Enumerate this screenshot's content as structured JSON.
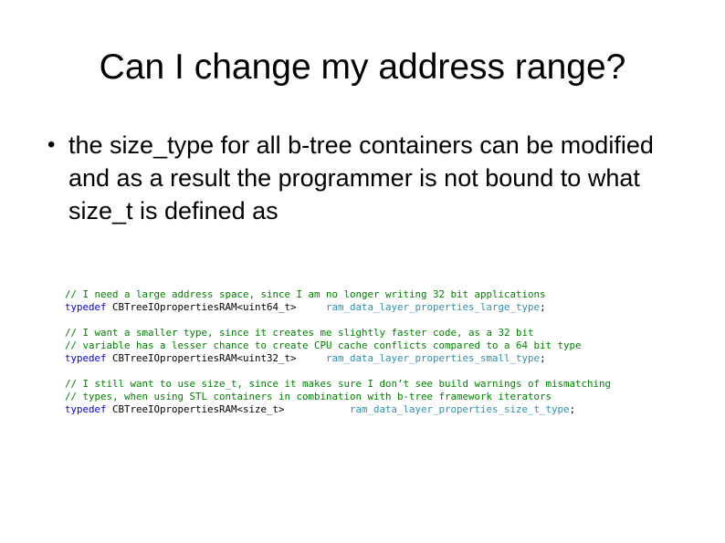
{
  "slide": {
    "title": "Can I change my address range?",
    "bullets": [
      "the size_type for all b-tree containers can be modified and as a result the programmer is not bound to what size_t is defined as"
    ]
  },
  "code": {
    "lines": [
      {
        "comment": "// I need a large address space, since I am no longer writing 32 bit applications"
      },
      {
        "keyword": "typedef",
        "type": " CBTreeIOpropertiesRAM<uint64_t>",
        "gap": "     ",
        "name": "ram_data_layer_properties_large_type",
        "end": ";"
      },
      {
        "blank": " "
      },
      {
        "comment": "// I want a smaller type, since it creates me slightly faster code, as a 32 bit"
      },
      {
        "comment": "// variable has a lesser chance to create CPU cache conflicts compared to a 64 bit type"
      },
      {
        "keyword": "typedef",
        "type": " CBTreeIOpropertiesRAM<uint32_t>",
        "gap": "     ",
        "name": "ram_data_layer_properties_small_type",
        "end": ";"
      },
      {
        "blank": " "
      },
      {
        "comment": "// I still want to use size_t, since it makes sure I don’t see build warnings of mismatching"
      },
      {
        "comment": "// types, when using STL containers in combination with b-tree framework iterators"
      },
      {
        "keyword": "typedef",
        "type": " CBTreeIOpropertiesRAM<size_t>",
        "gap": "           ",
        "name": "ram_data_layer_properties_size_t_type",
        "end": ";"
      }
    ]
  },
  "colors": {
    "comment": "#008000",
    "keyword": "#0000ff",
    "identifier": "#2b91af",
    "text": "#000000",
    "background": "#ffffff"
  }
}
